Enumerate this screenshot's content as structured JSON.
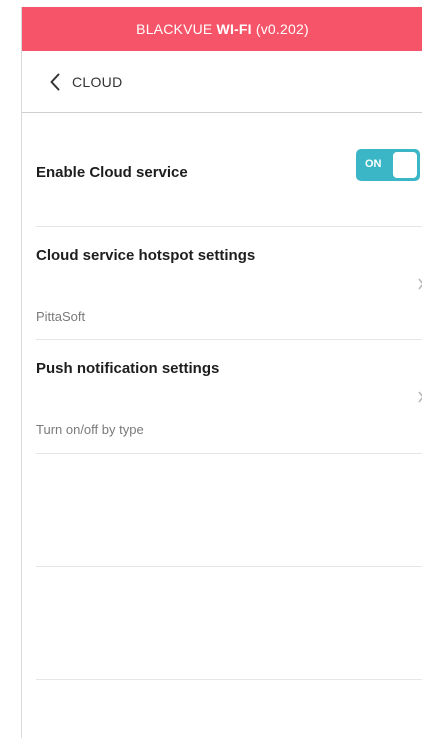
{
  "colors": {
    "app_bar": "#f65468",
    "toggle_on": "#3ab6c6",
    "divider": "#e6e6e6"
  },
  "app_bar": {
    "title_prefix": "BLACKVUE ",
    "title_bold": "WI-FI",
    "title_suffix": " (v0.202)"
  },
  "nav": {
    "back_icon": "chevron-left-icon",
    "title": "CLOUD"
  },
  "settings": {
    "cloud_service": {
      "label": "Enable Cloud service",
      "toggle_state": "ON",
      "enabled": true
    },
    "hotspot": {
      "label": "Cloud service hotspot settings",
      "value": "PittaSoft"
    },
    "push": {
      "label": "Push notification settings",
      "value": "Turn on/off by type"
    }
  }
}
